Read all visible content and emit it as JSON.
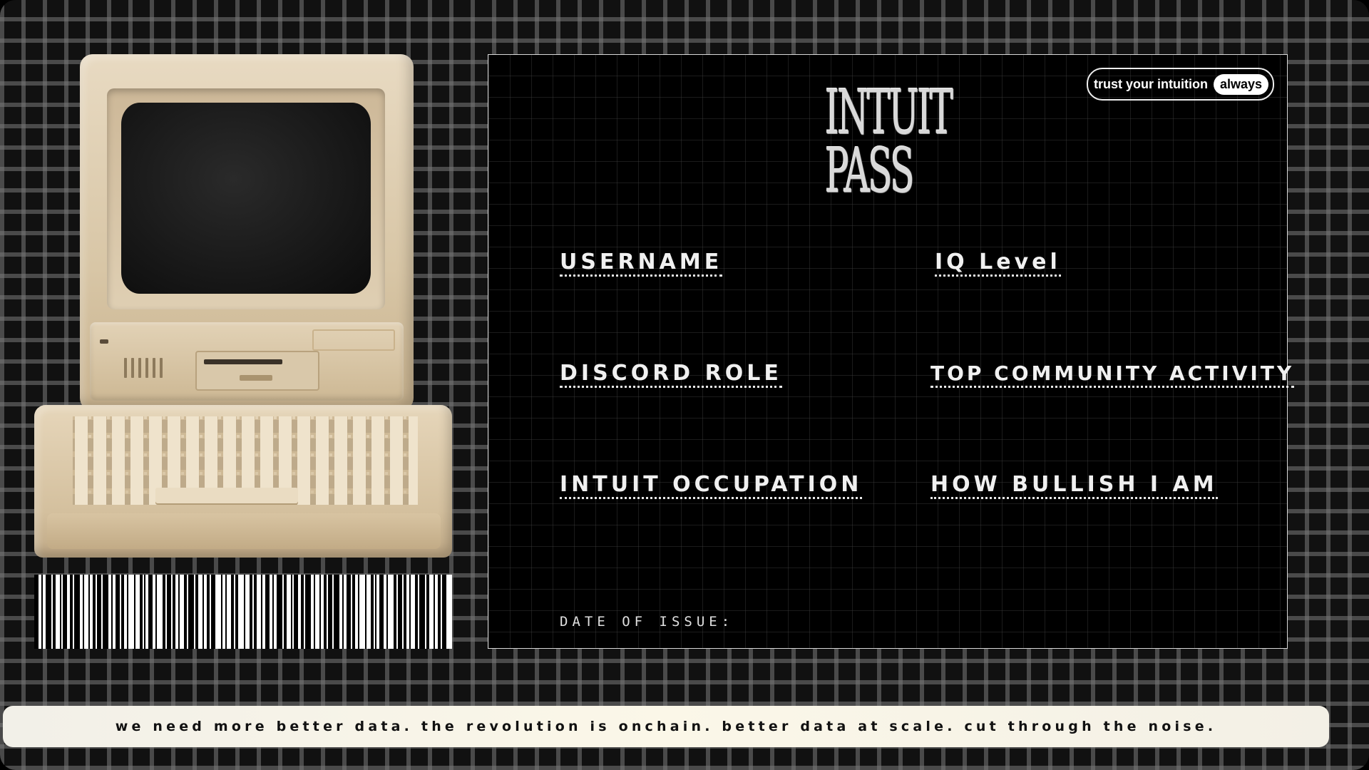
{
  "pass": {
    "logo_line1": "INTUIT",
    "logo_line2": "PASS",
    "badge_text": "trust your intuition",
    "badge_pill": "always",
    "fields": {
      "username": "USERNAME",
      "iq_level": "IQ Level",
      "discord_role": "DISCORD ROLE",
      "top_activity": "TOP COMMUNITY ACTIVITY",
      "occupation": "INTUIT OCCUPATION",
      "bullish": "HOW BULLISH I AM"
    },
    "date_label": "DATE OF ISSUE:"
  },
  "ticker": {
    "text": "we need more better data. the revolution is onchain. better data at scale. cut through the noise."
  },
  "colors": {
    "background": "#111111",
    "grid": "#787878",
    "computer_beige": "#d8c6a6",
    "ticker_bg": "#f7f4e8"
  },
  "icons": {
    "illustration": "retro-computer-icon",
    "barcode": "barcode-icon"
  }
}
